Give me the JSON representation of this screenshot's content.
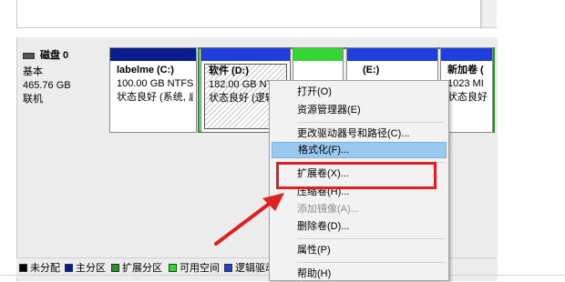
{
  "disk": {
    "name": "磁盘 0",
    "type": "基本",
    "size": "465.76 GB",
    "status": "联机"
  },
  "partitions": [
    {
      "label": "labelme  (C:)",
      "size": "100.00 GB NTFS",
      "status": "状态良好 (系统, 启"
    },
    {
      "label": "软件  (D:)",
      "size": "182.00 GB NTFS",
      "status": "状态良好 (逻辑"
    },
    {
      "label": "",
      "size": "",
      "status": ""
    },
    {
      "label": "(E:)",
      "size": "",
      "status": ""
    },
    {
      "label": "新加卷  (",
      "size": "1023 MI",
      "status": "状态良好"
    }
  ],
  "colors": {
    "primary_bar": "#0a1d8c",
    "logical_bar": "#1f3ee0",
    "free_bar": "#33d633",
    "extended": "#1a9b1a",
    "unallocated": "#000000",
    "highlight": "#99c9ef",
    "annotation_red": "#e02020"
  },
  "legend": [
    {
      "label": "未分配",
      "color": "#000000"
    },
    {
      "label": "主分区",
      "color": "#0a1d8c"
    },
    {
      "label": "扩展分区",
      "color": "#1a9b1a"
    },
    {
      "label": "可用空间",
      "color": "#33d633"
    },
    {
      "label": "逻辑驱动器",
      "color": "#1f3ee0"
    }
  ],
  "context_menu": {
    "open": "打开(O)",
    "explore": "资源管理器(E)",
    "change_letter": "更改驱动器号和路径(C)...",
    "format": "格式化(F)...",
    "extend": "扩展卷(X)...",
    "shrink": "压缩卷(H)...",
    "add_mirror": "添加镜像(A)...",
    "delete": "删除卷(D)...",
    "properties": "属性(P)",
    "help": "帮助(H)"
  }
}
